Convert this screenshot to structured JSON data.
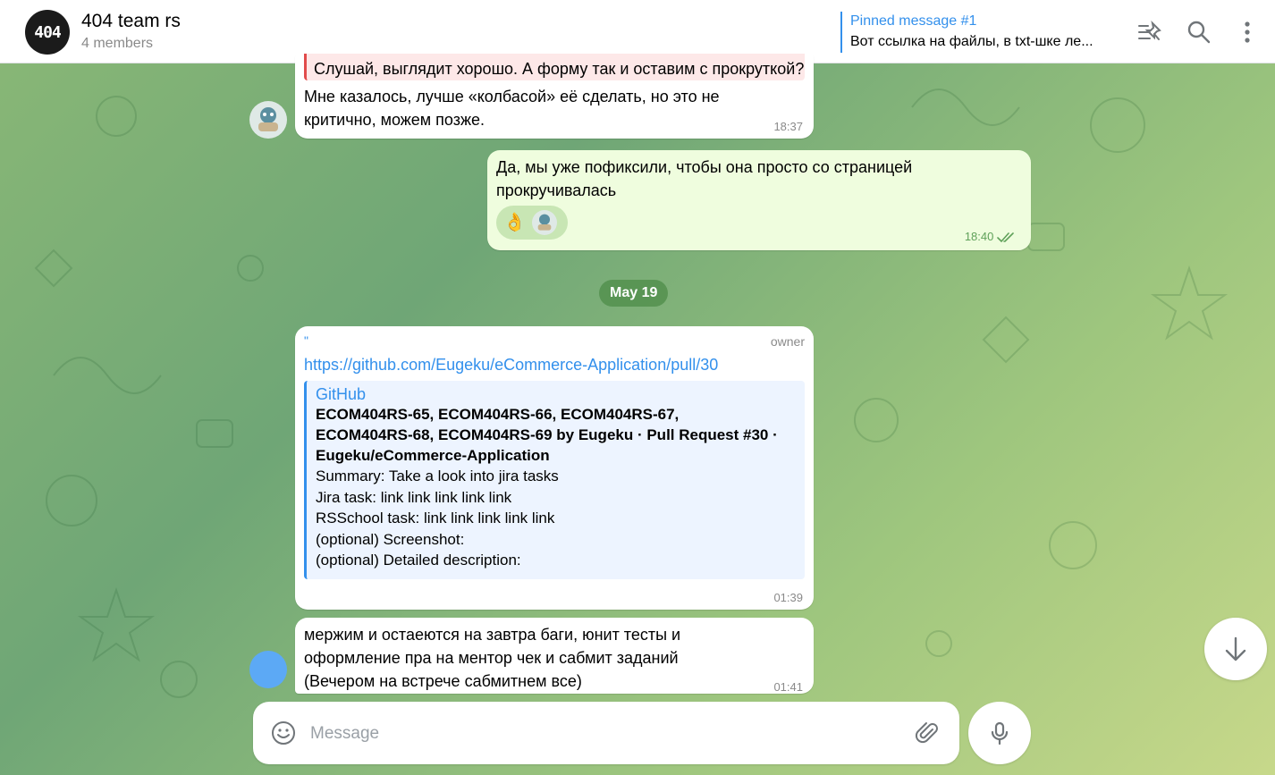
{
  "header": {
    "avatar_text": "404",
    "title": "404 team rs",
    "members": "4 members",
    "pinned_title": "Pinned message #1",
    "pinned_text": "Вот ссылка на файлы, в txt-шке ле..."
  },
  "messages": {
    "m1": {
      "quote": "Слушай, выглядит хорошо. А форму так и оставим с прокруткой?",
      "text_line1": "Мне казалось, лучше «колбасой» её сделать, но это не",
      "text_line2": "критично, можем позже.",
      "time": "18:37"
    },
    "m2": {
      "text_line1": "Да, мы уже пофиксили, чтобы она просто со страницей",
      "text_line2": "прокручивалась",
      "reaction": "👌",
      "time": "18:40"
    },
    "date": "May 19",
    "m3": {
      "sender_mark": "\"",
      "badge": "owner",
      "link": "https://github.com/Eugeku/eCommerce-Application/pull/30",
      "preview_site": "GitHub",
      "preview_title_1": "ECOM404RS-65, ECOM404RS-66, ECOM404RS-67,",
      "preview_title_2": "ECOM404RS-68, ECOM404RS-69 by Eugeku · Pull Request #30 ·",
      "preview_title_3": "Eugeku/eCommerce-Application",
      "preview_desc_1": "Summary: Take a look into jira tasks",
      "preview_desc_2": "Jira task: link link link link link",
      "preview_desc_3": "RSSchool task: link link link link link",
      "preview_desc_4": "(optional) Screenshot:",
      "preview_desc_5": "(optional) Detailed description:",
      "time": "01:39"
    },
    "m4": {
      "text_line1": "мержим и остаеются на завтра баги, юнит тесты и",
      "text_line2": "оформление пра на ментор чек и сабмит заданий",
      "text_line3": "(Вечером на встрече сабмитнем все)",
      "time": "01:41"
    }
  },
  "composer": {
    "placeholder": "Message"
  },
  "icons": {
    "pin": "pin-list-icon",
    "search": "search-icon",
    "more": "more-vertical-icon",
    "emoji": "emoji-icon",
    "attach": "paperclip-icon",
    "mic": "microphone-icon",
    "scroll": "arrow-down-icon"
  },
  "colors": {
    "accent": "#3390ec",
    "outgoing_bubble": "#effdde",
    "read_check": "#5fa159"
  }
}
